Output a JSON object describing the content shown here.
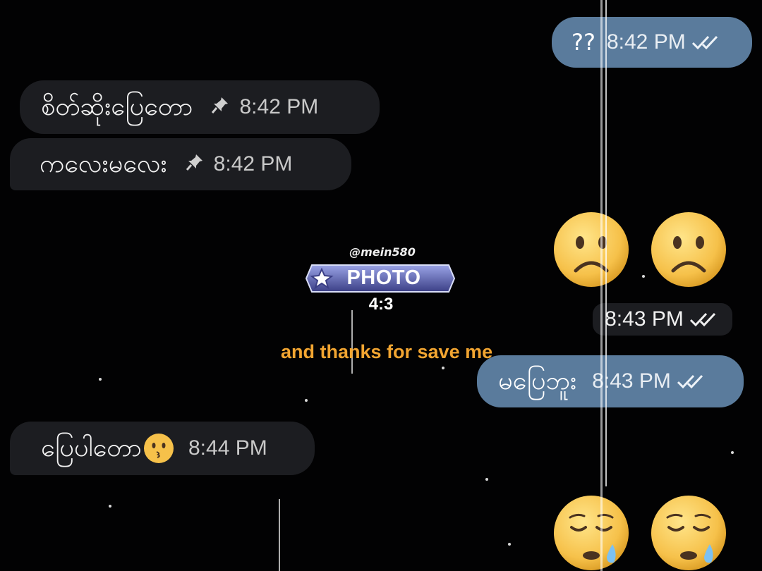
{
  "messages": {
    "out_1": {
      "text": "??",
      "time": "8:42 PM",
      "status": "read"
    },
    "in_1": {
      "text": "စိတ်ဆိုးပြေတော",
      "time": "8:42 PM",
      "icon": "pin-icon"
    },
    "in_2": {
      "text": "ကလေးမလေး",
      "time": "8:42 PM",
      "icon": "pin-icon"
    },
    "out_emoji_1": {
      "emojis": [
        "frowning-face",
        "frowning-face"
      ],
      "time": "8:43 PM",
      "status": "read"
    },
    "out_2": {
      "text": "မပြေဘူး",
      "time": "8:43 PM",
      "status": "read"
    },
    "in_3": {
      "text": "ပြေပါတော",
      "emoji": "kissing-face",
      "time": "8:44 PM"
    },
    "out_emoji_2": {
      "emojis": [
        "sleepy-face",
        "sleepy-face"
      ]
    }
  },
  "overlay": {
    "handle": "@mein580",
    "label": "PHOTO",
    "ratio": "4:3",
    "caption": "and thanks for save me"
  },
  "colors": {
    "background": "#020203",
    "incoming_bubble": "#1c1d21",
    "outgoing_bubble": "#5a7b9c",
    "caption": "#f2a531"
  }
}
